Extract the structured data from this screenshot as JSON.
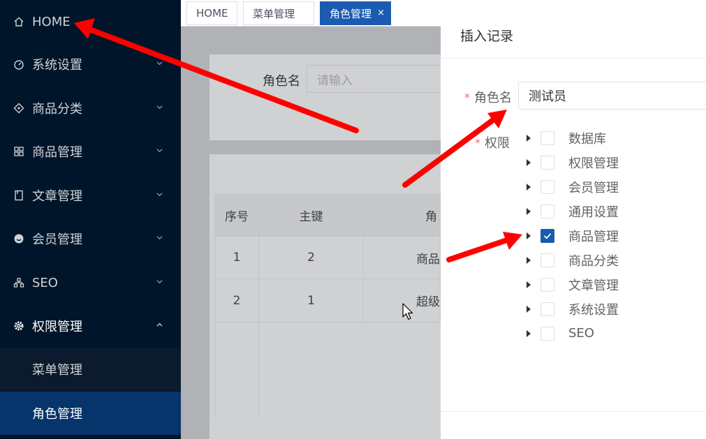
{
  "sidebar": {
    "items": [
      {
        "label": "HOME",
        "icon": "home-icon"
      },
      {
        "label": "系统设置",
        "icon": "dashboard-icon"
      },
      {
        "label": "商品分类",
        "icon": "category-icon"
      },
      {
        "label": "商品管理",
        "icon": "grid-icon"
      },
      {
        "label": "文章管理",
        "icon": "document-icon"
      },
      {
        "label": "会员管理",
        "icon": "member-icon"
      },
      {
        "label": "SEO",
        "icon": "sitemap-icon"
      },
      {
        "label": "权限管理",
        "icon": "gear-icon"
      }
    ],
    "subitems": [
      {
        "label": "菜单管理"
      },
      {
        "label": "角色管理"
      }
    ]
  },
  "tabs": [
    {
      "label": "HOME"
    },
    {
      "label": "菜单管理"
    },
    {
      "label": "角色管理",
      "close": "×"
    }
  ],
  "search": {
    "label": "角色名",
    "placeholder": "请输入"
  },
  "table": {
    "headers": [
      "序号",
      "主键",
      "角"
    ],
    "rows": [
      [
        "1",
        "2",
        "商品"
      ],
      [
        "2",
        "1",
        "超级"
      ]
    ]
  },
  "dialog": {
    "title": "插入记录",
    "role_label": "角色名",
    "role_value": "测试员",
    "perm_label": "权限",
    "required_mark": "*",
    "tree": [
      {
        "label": "数据库",
        "checked": false
      },
      {
        "label": "权限管理",
        "checked": false
      },
      {
        "label": "会员管理",
        "checked": false
      },
      {
        "label": "通用设置",
        "checked": false
      },
      {
        "label": "商品管理",
        "checked": true
      },
      {
        "label": "商品分类",
        "checked": false
      },
      {
        "label": "文章管理",
        "checked": false
      },
      {
        "label": "系统设置",
        "checked": false
      },
      {
        "label": "SEO",
        "checked": false
      }
    ]
  },
  "colors": {
    "sidebar_bg": "#001529",
    "active_blue": "#1a5bb0",
    "annotation_arrow": "#ff0000",
    "required": "#f56c6c"
  }
}
